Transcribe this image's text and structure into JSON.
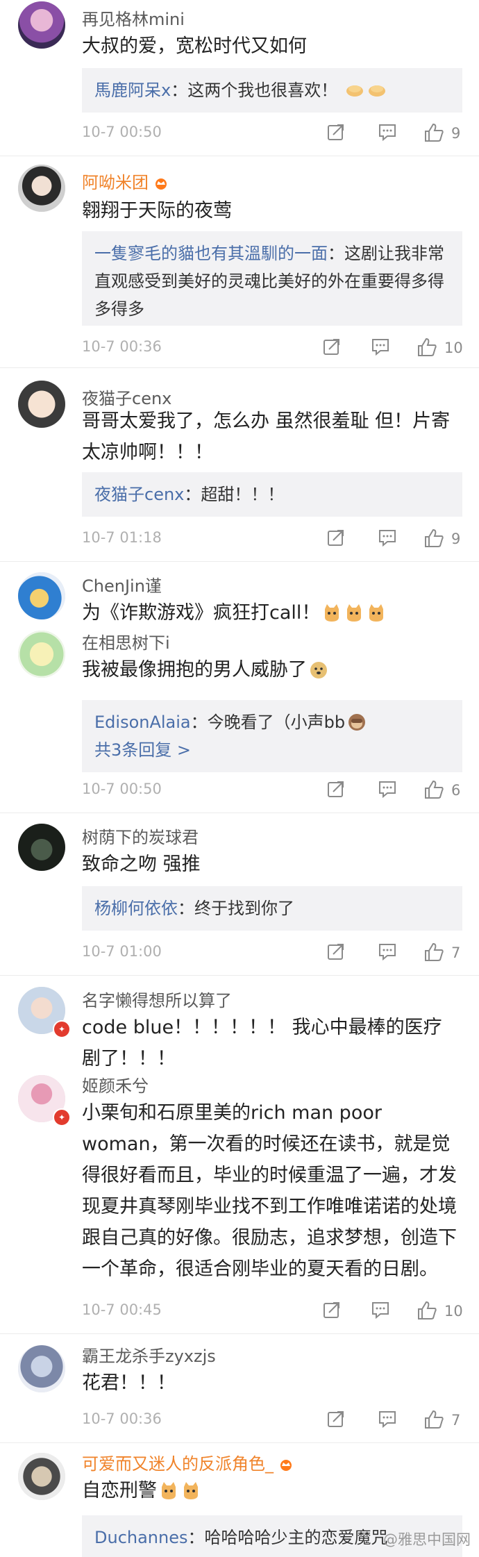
{
  "comments": [
    {
      "user": "再见格林mini",
      "text": "大叔的爱，宽松时代又如何",
      "reply_user": "馬鹿阿呆x",
      "reply_text": "：这两个我也很喜欢！",
      "time": "10-7 00:50",
      "likes": "9"
    },
    {
      "user": "阿呦米团",
      "text": "翱翔于天际的夜莺",
      "reply_user": "一隻寥毛的貓也有其溫馴的一面",
      "reply_text": "：这剧让我非常直观感受到美好的灵魂比美好的外在重要得多得多得多",
      "time": "10-7 00:36",
      "likes": "10"
    },
    {
      "user": "夜猫子cenx",
      "text": "哥哥太爱我了，怎么办 虽然很羞耻 但！片寄太凉帅啊！！！",
      "reply_user": "夜猫子cenx",
      "reply_text": "：超甜！！！",
      "time": "10-7 01:18",
      "likes": "9"
    },
    {
      "user": "ChenJin谨",
      "text": "为《诈欺游戏》疯狂打call！"
    },
    {
      "user": "在相思树下i",
      "text": "我被最像拥抱的男人威胁了",
      "reply_user": "EdisonAlaia",
      "reply_text": "：今晚看了（小声bb",
      "reply_more": "共3条回复 >",
      "time": "10-7 00:50",
      "likes": "6"
    },
    {
      "user": "树荫下的炭球君",
      "text": "致命之吻  强推",
      "reply_user": "杨柳何依依",
      "reply_text": "：终于找到你了",
      "time": "10-7 01:00",
      "likes": "7"
    },
    {
      "user": "名字懒得想所以算了",
      "text": "code blue！！！！！！ 我心中最棒的医疗剧了！！！"
    },
    {
      "user": "姬颜禾兮",
      "text": "小栗旬和石原里美的rich man poor woman，第一次看的时候还在读书，就是觉得很好看而且，毕业的时候重温了一遍，才发现夏井真琴刚毕业找不到工作唯唯诺诺的处境跟自己真的好像。很励志，追求梦想，创造下一个革命，很适合刚毕业的夏天看的日剧。",
      "time": "10-7 00:45",
      "likes": "10"
    },
    {
      "user": "霸王龙杀手zyxzjs",
      "text": "花君！！！",
      "time": "10-7 00:36",
      "likes": "7"
    },
    {
      "user": "可爱而又迷人的反派角色_",
      "text": "自恋刑警",
      "reply_user": "Duchannes",
      "reply_text": "：哈哈哈哈少主的恋爱魔咒"
    }
  ],
  "watermark": "@雅思中国网",
  "colors": {
    "name_orange": "#f0832a",
    "reply_link": "#4a6ea9",
    "reply_bg": "#f2f2f4"
  }
}
